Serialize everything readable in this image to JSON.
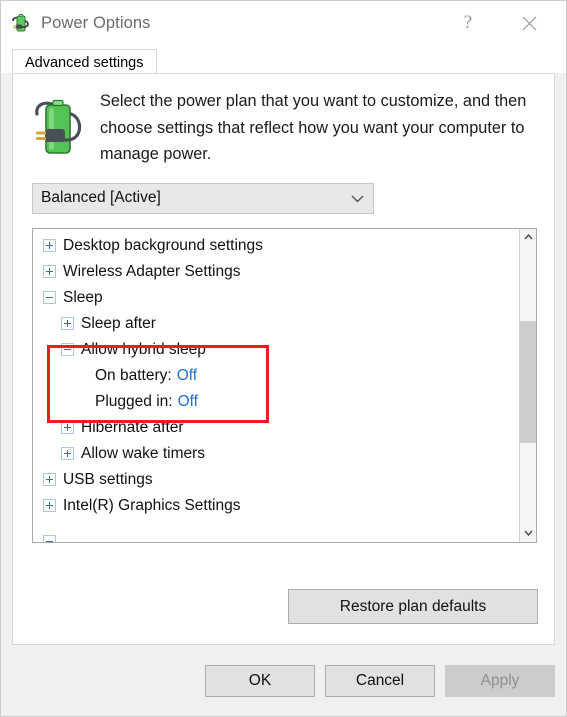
{
  "window": {
    "title": "Power Options",
    "icon": "power-plug-battery-icon",
    "help_label": "?",
    "close_label": "✕"
  },
  "tabs": [
    {
      "label": "Advanced settings",
      "selected": true
    }
  ],
  "header": {
    "icon": "battery-power-plug-icon",
    "description": "Select the power plan that you want to customize, and then choose settings that reflect how you want your computer to manage power."
  },
  "plan_select": {
    "value": "Balanced [Active]",
    "arrow_icon": "chevron-down-icon"
  },
  "settings_tree": [
    {
      "level": 0,
      "expander": "plus",
      "label": "Desktop background settings"
    },
    {
      "level": 0,
      "expander": "plus",
      "label": "Wireless Adapter Settings"
    },
    {
      "level": 0,
      "expander": "minus",
      "label": "Sleep"
    },
    {
      "level": 1,
      "expander": "plus",
      "label": "Sleep after"
    },
    {
      "level": 1,
      "expander": "minus",
      "label": "Allow hybrid sleep"
    },
    {
      "level": 2,
      "expander": "none",
      "label": "On battery:",
      "value": "Off"
    },
    {
      "level": 2,
      "expander": "none",
      "label": "Plugged in:",
      "value": "Off"
    },
    {
      "level": 1,
      "expander": "plus",
      "label": "Hibernate after"
    },
    {
      "level": 1,
      "expander": "plus",
      "label": "Allow wake timers"
    },
    {
      "level": 0,
      "expander": "plus",
      "label": "USB settings"
    },
    {
      "level": 0,
      "expander": "plus",
      "label": "Intel(R) Graphics Settings"
    }
  ],
  "scrollbar": {
    "up_icon": "chevron-up-icon",
    "down_icon": "chevron-down-icon"
  },
  "annotation": {
    "color": "#ee1c1c",
    "targets": [
      "Allow hybrid sleep",
      "On battery: Off",
      "Plugged in: Off"
    ]
  },
  "restore": {
    "label": "Restore plan defaults"
  },
  "footer": {
    "ok_label": "OK",
    "cancel_label": "Cancel",
    "apply_label": "Apply",
    "apply_disabled": true
  },
  "colors": {
    "link_blue": "#1f6fd0",
    "annotation_red": "#ee1c1c",
    "window_bg": "#f0f0f0"
  }
}
